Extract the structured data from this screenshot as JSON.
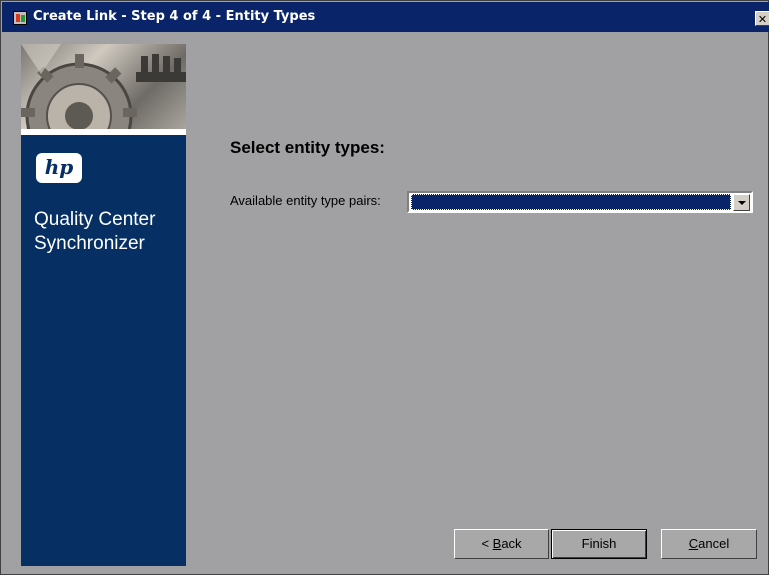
{
  "window": {
    "title": "Create Link - Step 4 of 4 - Entity Types",
    "close_glyph": "✕"
  },
  "sidebar": {
    "logo_text": "hp",
    "product_line1": "Quality Center",
    "product_line2": "Synchronizer"
  },
  "main": {
    "heading": "Select entity types:",
    "entity_label": "Available entity type pairs:",
    "entity_value": ""
  },
  "buttons": {
    "back_prefix": "< ",
    "back_mnemonic": "B",
    "back_rest": "ack",
    "finish": "Finish",
    "cancel_mnemonic": "C",
    "cancel_rest": "ancel"
  },
  "colors": {
    "title_bar": "#0a246a",
    "sidebar_panel": "#063063",
    "dialog_background": "#a1a1a4"
  },
  "icons": {
    "app": "sync-app-icon",
    "banner": "gear-banner-image",
    "dropdown": "dropdown-arrow-icon",
    "close": "close-icon"
  }
}
